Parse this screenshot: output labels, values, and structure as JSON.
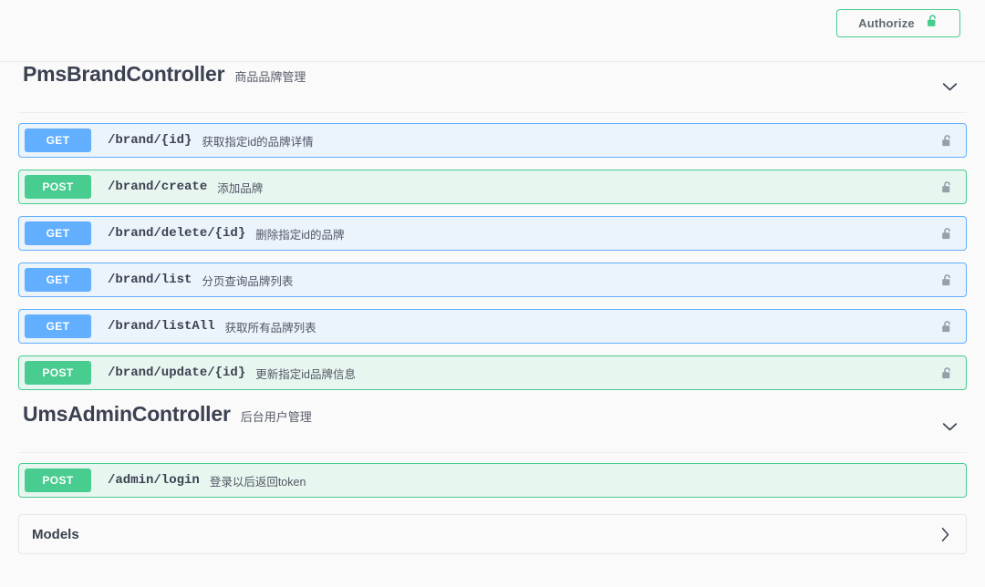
{
  "topbar": {
    "authorize": {
      "label": "Authorize",
      "icon": "unlock-icon",
      "border_color": "#49cc90",
      "text_color": "#5c6b72"
    }
  },
  "colors": {
    "get": "#61affe",
    "get_row_bg": "#ebf3fb",
    "post": "#49cc90",
    "post_row_bg": "#e8f6f0",
    "text": "#3b4151",
    "page_bg": "#fafafa"
  },
  "tags": [
    {
      "name": "PmsBrandController",
      "description": "商品品牌管理",
      "expanded": true,
      "toggle_icon": "chevron-down-icon",
      "operations": [
        {
          "method": "GET",
          "path": "/brand/{id}",
          "summary": "获取指定id的品牌详情",
          "lock_icon": "unlock-icon"
        },
        {
          "method": "POST",
          "path": "/brand/create",
          "summary": "添加品牌",
          "lock_icon": "unlock-icon"
        },
        {
          "method": "GET",
          "path": "/brand/delete/{id}",
          "summary": "删除指定id的品牌",
          "lock_icon": "unlock-icon"
        },
        {
          "method": "GET",
          "path": "/brand/list",
          "summary": "分页查询品牌列表",
          "lock_icon": "unlock-icon"
        },
        {
          "method": "GET",
          "path": "/brand/listAll",
          "summary": "获取所有品牌列表",
          "lock_icon": "unlock-icon"
        },
        {
          "method": "POST",
          "path": "/brand/update/{id}",
          "summary": "更新指定id品牌信息",
          "lock_icon": "unlock-icon"
        }
      ]
    },
    {
      "name": "UmsAdminController",
      "description": "后台用户管理",
      "expanded": true,
      "toggle_icon": "chevron-down-icon",
      "operations": [
        {
          "method": "POST",
          "path": "/admin/login",
          "summary": "登录以后返回token",
          "lock_icon": "none"
        }
      ]
    }
  ],
  "models": {
    "title": "Models",
    "expanded": false,
    "toggle_icon": "chevron-right-icon"
  }
}
